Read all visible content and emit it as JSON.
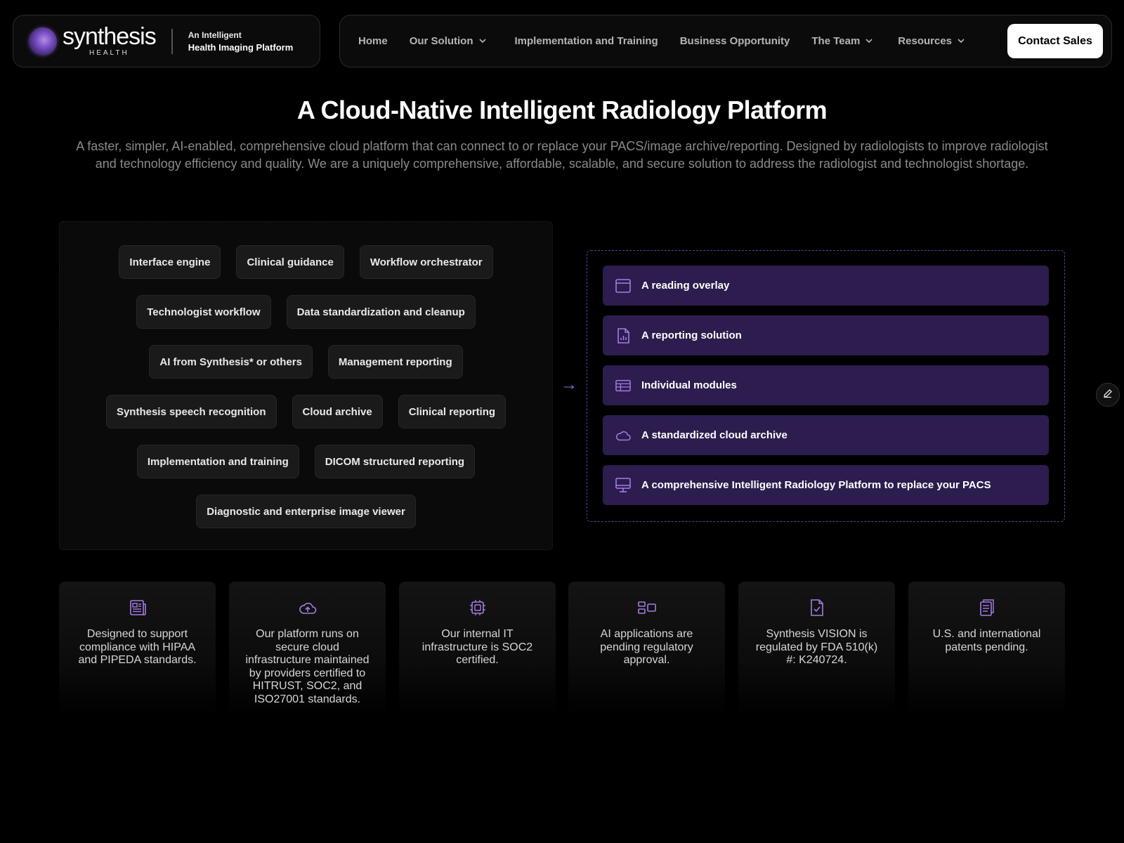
{
  "brand": {
    "logo_word": "synthesis",
    "logo_sub": "HEALTH",
    "tagline_line1": "An Intelligent",
    "tagline_line2": "Health Imaging Platform"
  },
  "nav": {
    "items": [
      {
        "label": "Home",
        "dropdown": false
      },
      {
        "label": "Our Solution",
        "dropdown": true
      },
      {
        "label": "Implementation and Training",
        "dropdown": false
      },
      {
        "label": "Business Opportunity",
        "dropdown": false
      },
      {
        "label": "The Team",
        "dropdown": true
      },
      {
        "label": "Resources",
        "dropdown": true
      }
    ],
    "cta_label": "Contact Sales"
  },
  "hero": {
    "title": "A Cloud-Native Intelligent Radiology Platform",
    "description": "A faster, simpler, AI-enabled, comprehensive cloud platform that can connect to or replace your PACS/image archive/reporting.  Designed by radiologists to improve radiologist and technology efficiency and quality.  We are a uniquely comprehensive, affordable, scalable, and secure solution to address the radiologist and technologist shortage."
  },
  "components": [
    [
      "Interface engine",
      "Clinical guidance",
      "Workflow orchestrator"
    ],
    [
      "Technologist workflow",
      "Data standardization and cleanup"
    ],
    [
      "AI from Synthesis* or others",
      "Management reporting"
    ],
    [
      "Synthesis speech recognition",
      "Cloud archive",
      "Clinical reporting"
    ],
    [
      "Implementation and training",
      "DICOM structured reporting"
    ],
    [
      "Diagnostic and enterprise image viewer"
    ]
  ],
  "arrow_glyph": "→",
  "options": [
    {
      "label": "A reading overlay",
      "icon": "window-icon"
    },
    {
      "label": "A reporting solution",
      "icon": "report-chart-icon"
    },
    {
      "label": "Individual modules",
      "icon": "table-icon"
    },
    {
      "label": "A standardized cloud archive",
      "icon": "cloud-icon"
    },
    {
      "label": "A comprehensive Intelligent Radiology Platform to replace your PACS",
      "icon": "monitor-icon"
    }
  ],
  "cards": [
    {
      "icon": "newspaper-icon",
      "text": "Designed to support compliance with HIPAA and PIPEDA standards."
    },
    {
      "icon": "cloud-upload-icon",
      "text": "Our platform runs on secure cloud infrastructure maintained by providers certified to HITRUST, SOC2, and ISO27001 standards."
    },
    {
      "icon": "cpu-chip-icon",
      "text": "Our internal IT infrastructure is SOC2 certified."
    },
    {
      "icon": "apps-layout-icon",
      "text": "AI applications are pending regulatory approval."
    },
    {
      "icon": "document-check-icon",
      "text": "Synthesis VISION is regulated by FDA 510(k) #: K240724."
    },
    {
      "icon": "clipboard-icon",
      "text": "U.S. and international patents pending."
    }
  ],
  "colors": {
    "accent_purple": "#9a6fe0",
    "option_bg": "#2c1d4e",
    "background": "#000000"
  }
}
